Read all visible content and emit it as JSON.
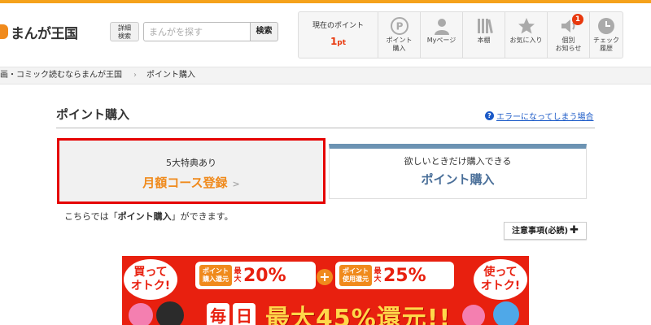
{
  "header": {
    "logo_text": "まんが王国",
    "advanced_search_label": "詳細\n検索",
    "search_placeholder": "まんがを探す",
    "search_button_label": "検索",
    "points": {
      "label": "現在のポイント",
      "value": "1",
      "unit": "pt"
    },
    "nav": [
      {
        "label": "ポイント\n購入",
        "icon": "point-coin-icon"
      },
      {
        "label": "Myページ",
        "icon": "user-icon"
      },
      {
        "label": "本棚",
        "icon": "bookshelf-icon"
      },
      {
        "label": "お気に入り",
        "icon": "star-icon"
      },
      {
        "label": "個別\nお知らせ",
        "icon": "speaker-icon",
        "badge": "1"
      },
      {
        "label": "チェック\n履歴",
        "icon": "clock-icon"
      }
    ]
  },
  "breadcrumb": {
    "home": "画・コミック読むならまんが王国",
    "current": "ポイント購入"
  },
  "main": {
    "title": "ポイント購入",
    "error_link": "エラーになってしまう場合",
    "tabs": {
      "monthly": {
        "sub": "5大特典あり",
        "main": "月額コース登録"
      },
      "point": {
        "sub": "欲しいときだけ購入できる",
        "main": "ポイント購入"
      }
    },
    "desc_prefix": "こちらでは「",
    "desc_bold": "ポイント購入",
    "desc_suffix": "」ができます。",
    "notes_button": "注意事項(必読)"
  },
  "banner": {
    "left_bubble": "買って\nオトク!",
    "right_bubble": "使って\nオトク!",
    "pill1_tag": "ポイント\n購入還元",
    "pill1_max": "最大",
    "pill1_value": "20%",
    "pill2_tag": "ポイント\n使用還元",
    "pill2_max": "最大",
    "pill2_value": "25%",
    "plus": "+",
    "daily_1": "毎",
    "daily_2": "日",
    "daily_big": "最大45%還元!!"
  },
  "colors": {
    "accent_orange": "#f08a1c",
    "highlight_red": "#e50000",
    "point_blue": "#4a6f99",
    "link_blue": "#1a59c7"
  }
}
